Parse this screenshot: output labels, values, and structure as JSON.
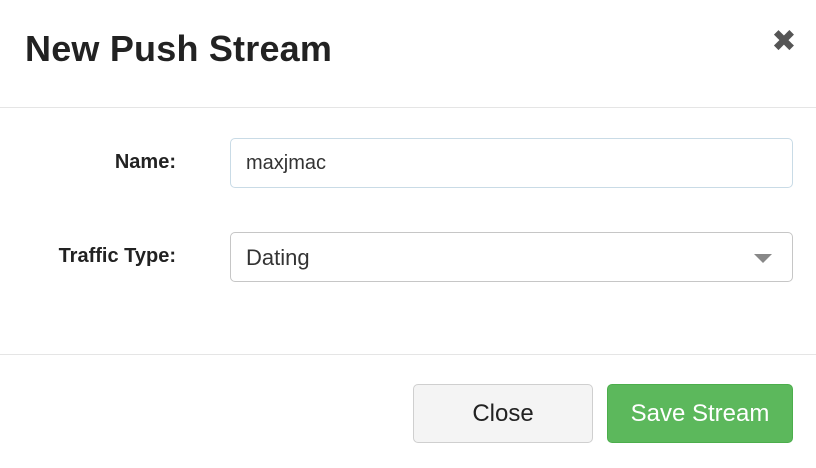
{
  "dialog": {
    "title": "New Push Stream",
    "close_icon": "close-icon",
    "close_glyph": "✖"
  },
  "form": {
    "name_label": "Name:",
    "name_value": "maxjmac",
    "traffic_type_label": "Traffic Type:",
    "traffic_type_value": "Dating",
    "dropdown_icon": "chevron-down-icon"
  },
  "footer": {
    "close_label": "Close",
    "save_label": "Save Stream"
  },
  "colors": {
    "primary_success": "#5cb85c",
    "secondary_button": "#f4f4f4"
  }
}
